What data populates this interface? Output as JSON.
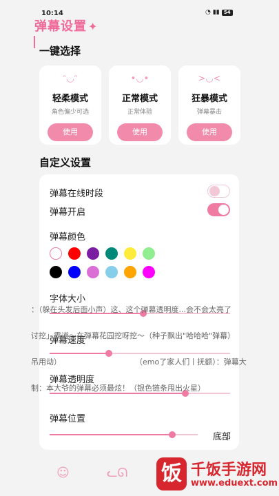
{
  "status_bar": {
    "time": "10:14",
    "network": "Wi-Fi 5G",
    "battery": "54"
  },
  "header": {
    "logo_text": "弹幕设置",
    "sparkle": "✦"
  },
  "sections": {
    "quick_select": "一键选择",
    "custom": "自定义设置"
  },
  "modes": [
    {
      "title": "轻柔模式",
      "sub": "角色偏少可选",
      "button": "使用",
      "icon": "gentle-face-icon"
    },
    {
      "title": "正常模式",
      "sub": "正常体验",
      "button": "使用",
      "icon": "normal-face-icon"
    },
    {
      "title": "狂暴模式",
      "sub": "弹幕暴击",
      "button": "使用",
      "icon": "wild-face-icon"
    }
  ],
  "settings": {
    "online_time": {
      "label": "弹幕在线时段",
      "on": false
    },
    "danmaku_on": {
      "label": "弹幕开启",
      "on": true
    },
    "color_label": "弹幕颜色",
    "colors": [
      "#ffffff",
      "#ff0000",
      "#7b1fa2",
      "#00897b",
      "#ffeb3b",
      "#90ee90",
      "#000000",
      "#0000ff",
      "#da70d6",
      "#87ceeb",
      "#ffa500",
      "#ff00ff"
    ],
    "font_size": {
      "label": "字体大小",
      "value": 0.52
    },
    "speed": {
      "label": "弹幕速度",
      "value": 0.33
    },
    "opacity": {
      "label": "弹幕透明度",
      "value": 0.75
    },
    "position": {
      "label": "弹幕位置",
      "value": 0.83,
      "end_label": "底部"
    }
  },
  "danmaku_lines": [
    "：（躲在头发后面小声）这、这个弹幕透明度...会不会太亮了",
    "讨挖」霸道～在弹幕花园挖呀挖～（种子飘出\"哈哈哈\"弹幕）",
    "吊用动）",
    "（emo了家人们丨抚额）：弹幕大",
    "制：本大爷的弹幕必须最炫！（银色链条甩出火星）"
  ],
  "tabbar": {
    "icons": [
      "home-face-icon",
      "cat-face-icon"
    ]
  },
  "watermark": {
    "badge": "饭",
    "brand": "千饭手游网",
    "site": "www.eduext.com"
  },
  "colors": {
    "accent": "#f07ba2",
    "accent_light": "#f3c6d6",
    "watermark": "#d8262e"
  }
}
